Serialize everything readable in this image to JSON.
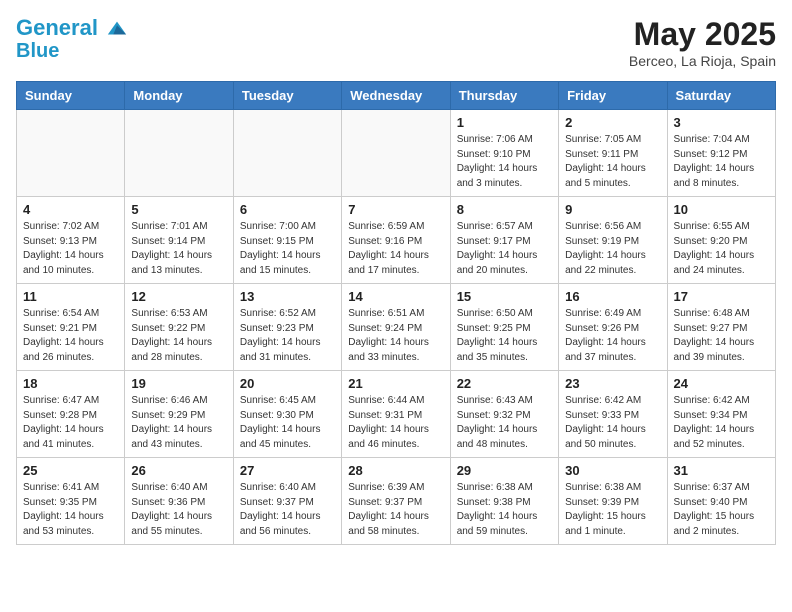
{
  "logo": {
    "line1": "General",
    "line2": "Blue"
  },
  "title": "May 2025",
  "location": "Berceo, La Rioja, Spain",
  "days_of_week": [
    "Sunday",
    "Monday",
    "Tuesday",
    "Wednesday",
    "Thursday",
    "Friday",
    "Saturday"
  ],
  "weeks": [
    [
      {
        "day": "",
        "info": ""
      },
      {
        "day": "",
        "info": ""
      },
      {
        "day": "",
        "info": ""
      },
      {
        "day": "",
        "info": ""
      },
      {
        "day": "1",
        "info": "Sunrise: 7:06 AM\nSunset: 9:10 PM\nDaylight: 14 hours\nand 3 minutes."
      },
      {
        "day": "2",
        "info": "Sunrise: 7:05 AM\nSunset: 9:11 PM\nDaylight: 14 hours\nand 5 minutes."
      },
      {
        "day": "3",
        "info": "Sunrise: 7:04 AM\nSunset: 9:12 PM\nDaylight: 14 hours\nand 8 minutes."
      }
    ],
    [
      {
        "day": "4",
        "info": "Sunrise: 7:02 AM\nSunset: 9:13 PM\nDaylight: 14 hours\nand 10 minutes."
      },
      {
        "day": "5",
        "info": "Sunrise: 7:01 AM\nSunset: 9:14 PM\nDaylight: 14 hours\nand 13 minutes."
      },
      {
        "day": "6",
        "info": "Sunrise: 7:00 AM\nSunset: 9:15 PM\nDaylight: 14 hours\nand 15 minutes."
      },
      {
        "day": "7",
        "info": "Sunrise: 6:59 AM\nSunset: 9:16 PM\nDaylight: 14 hours\nand 17 minutes."
      },
      {
        "day": "8",
        "info": "Sunrise: 6:57 AM\nSunset: 9:17 PM\nDaylight: 14 hours\nand 20 minutes."
      },
      {
        "day": "9",
        "info": "Sunrise: 6:56 AM\nSunset: 9:19 PM\nDaylight: 14 hours\nand 22 minutes."
      },
      {
        "day": "10",
        "info": "Sunrise: 6:55 AM\nSunset: 9:20 PM\nDaylight: 14 hours\nand 24 minutes."
      }
    ],
    [
      {
        "day": "11",
        "info": "Sunrise: 6:54 AM\nSunset: 9:21 PM\nDaylight: 14 hours\nand 26 minutes."
      },
      {
        "day": "12",
        "info": "Sunrise: 6:53 AM\nSunset: 9:22 PM\nDaylight: 14 hours\nand 28 minutes."
      },
      {
        "day": "13",
        "info": "Sunrise: 6:52 AM\nSunset: 9:23 PM\nDaylight: 14 hours\nand 31 minutes."
      },
      {
        "day": "14",
        "info": "Sunrise: 6:51 AM\nSunset: 9:24 PM\nDaylight: 14 hours\nand 33 minutes."
      },
      {
        "day": "15",
        "info": "Sunrise: 6:50 AM\nSunset: 9:25 PM\nDaylight: 14 hours\nand 35 minutes."
      },
      {
        "day": "16",
        "info": "Sunrise: 6:49 AM\nSunset: 9:26 PM\nDaylight: 14 hours\nand 37 minutes."
      },
      {
        "day": "17",
        "info": "Sunrise: 6:48 AM\nSunset: 9:27 PM\nDaylight: 14 hours\nand 39 minutes."
      }
    ],
    [
      {
        "day": "18",
        "info": "Sunrise: 6:47 AM\nSunset: 9:28 PM\nDaylight: 14 hours\nand 41 minutes."
      },
      {
        "day": "19",
        "info": "Sunrise: 6:46 AM\nSunset: 9:29 PM\nDaylight: 14 hours\nand 43 minutes."
      },
      {
        "day": "20",
        "info": "Sunrise: 6:45 AM\nSunset: 9:30 PM\nDaylight: 14 hours\nand 45 minutes."
      },
      {
        "day": "21",
        "info": "Sunrise: 6:44 AM\nSunset: 9:31 PM\nDaylight: 14 hours\nand 46 minutes."
      },
      {
        "day": "22",
        "info": "Sunrise: 6:43 AM\nSunset: 9:32 PM\nDaylight: 14 hours\nand 48 minutes."
      },
      {
        "day": "23",
        "info": "Sunrise: 6:42 AM\nSunset: 9:33 PM\nDaylight: 14 hours\nand 50 minutes."
      },
      {
        "day": "24",
        "info": "Sunrise: 6:42 AM\nSunset: 9:34 PM\nDaylight: 14 hours\nand 52 minutes."
      }
    ],
    [
      {
        "day": "25",
        "info": "Sunrise: 6:41 AM\nSunset: 9:35 PM\nDaylight: 14 hours\nand 53 minutes."
      },
      {
        "day": "26",
        "info": "Sunrise: 6:40 AM\nSunset: 9:36 PM\nDaylight: 14 hours\nand 55 minutes."
      },
      {
        "day": "27",
        "info": "Sunrise: 6:40 AM\nSunset: 9:37 PM\nDaylight: 14 hours\nand 56 minutes."
      },
      {
        "day": "28",
        "info": "Sunrise: 6:39 AM\nSunset: 9:37 PM\nDaylight: 14 hours\nand 58 minutes."
      },
      {
        "day": "29",
        "info": "Sunrise: 6:38 AM\nSunset: 9:38 PM\nDaylight: 14 hours\nand 59 minutes."
      },
      {
        "day": "30",
        "info": "Sunrise: 6:38 AM\nSunset: 9:39 PM\nDaylight: 15 hours\nand 1 minute."
      },
      {
        "day": "31",
        "info": "Sunrise: 6:37 AM\nSunset: 9:40 PM\nDaylight: 15 hours\nand 2 minutes."
      }
    ]
  ]
}
